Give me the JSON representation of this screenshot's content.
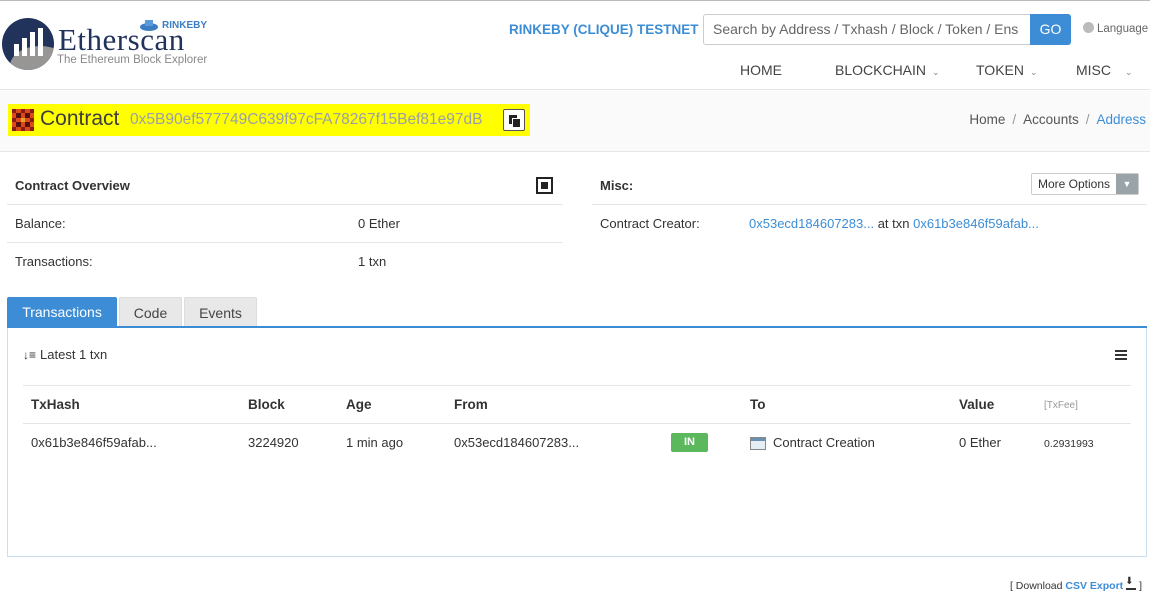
{
  "header": {
    "logo_text": "Etherscan",
    "logo_subtitle": "The Ethereum Block Explorer",
    "logo_network": "RINKEBY",
    "network_label": "RINKEBY (CLIQUE) TESTNET",
    "search_placeholder": "Search by Address / Txhash / Block / Token / Ens",
    "go_label": "GO",
    "language_label": "Language",
    "nav": [
      {
        "label": "HOME"
      },
      {
        "label": "BLOCKCHAIN"
      },
      {
        "label": "TOKEN"
      },
      {
        "label": "MISC"
      }
    ]
  },
  "titlebar": {
    "title": "Contract",
    "address": "0x5B90ef577749C639f97cFA78267f15Bef81e97dB",
    "breadcrumb": [
      "Home",
      "Accounts",
      "Address"
    ]
  },
  "overview": {
    "heading": "Contract Overview",
    "balance_label": "Balance:",
    "balance_value": "0 Ether",
    "transactions_label": "Transactions:",
    "transactions_value": "1 txn"
  },
  "misc": {
    "heading": "Misc:",
    "more_options": "More Options",
    "creator_label": "Contract Creator:",
    "creator_address": "0x53ecd184607283...",
    "creator_at": "at txn",
    "creator_txn": "0x61b3e846f59afab..."
  },
  "tabs": [
    {
      "label": "Transactions",
      "active": true
    },
    {
      "label": "Code",
      "active": false
    },
    {
      "label": "Events",
      "active": false
    }
  ],
  "transactions": {
    "summary": "Latest 1 txn",
    "columns": {
      "txhash": "TxHash",
      "block": "Block",
      "age": "Age",
      "from": "From",
      "to": "To",
      "value": "Value",
      "fee": "[TxFee]"
    },
    "rows": [
      {
        "txhash": "0x61b3e846f59afab...",
        "block": "3224920",
        "age": "1 min ago",
        "from": "0x53ecd184607283...",
        "direction": "IN",
        "to": "Contract Creation",
        "value": "0 Ether",
        "fee": "0.2931993"
      }
    ]
  },
  "footer": {
    "download_prefix": "[ Download",
    "csv_label": "CSV Export",
    "suffix": "]"
  },
  "colors": {
    "brand": "#21325b",
    "accent": "#3c8dd5",
    "highlight": "#ffff00",
    "in_badge": "#5cb85c"
  },
  "icons": [
    "logo-icon",
    "copy-icon",
    "qr-code-icon",
    "sort-icon",
    "menu-icon",
    "contract-icon",
    "download-icon",
    "globe-icon",
    "chevron-down-icon"
  ]
}
